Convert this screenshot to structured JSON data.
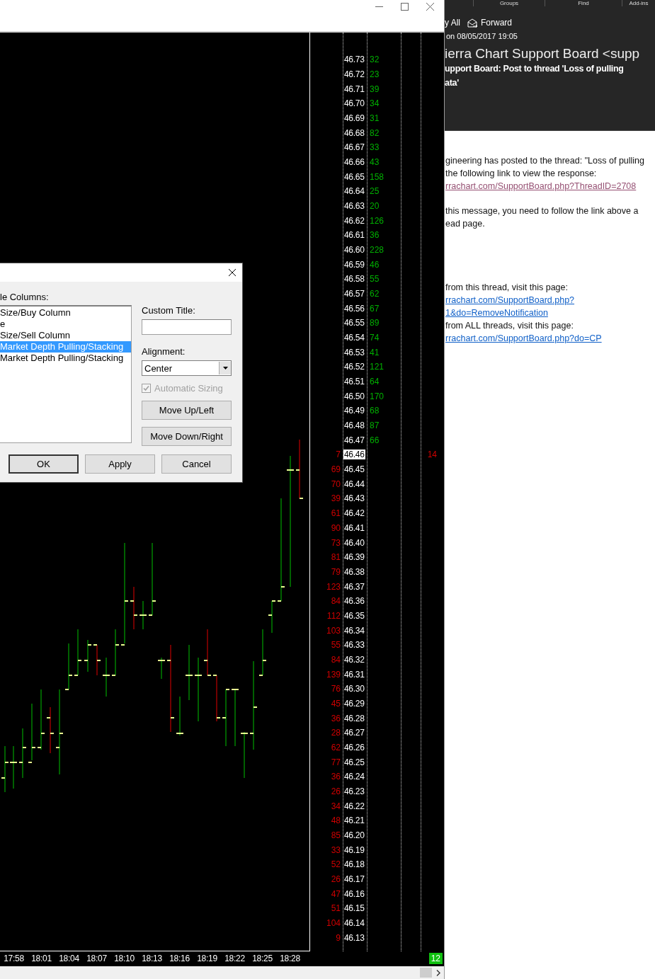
{
  "chart": {
    "ladder": {
      "rows": [
        {
          "price": "46.73",
          "ask": "32",
          "highlighted": false
        },
        {
          "price": "46.72",
          "ask": "23",
          "highlighted": false
        },
        {
          "price": "46.71",
          "ask": "39",
          "highlighted": false
        },
        {
          "price": "46.70",
          "ask": "34",
          "highlighted": false
        },
        {
          "price": "46.69",
          "ask": "31",
          "highlighted": false
        },
        {
          "price": "46.68",
          "ask": "82",
          "highlighted": false
        },
        {
          "price": "46.67",
          "ask": "33",
          "highlighted": false
        },
        {
          "price": "46.66",
          "ask": "43",
          "highlighted": false
        },
        {
          "price": "46.65",
          "ask": "158",
          "highlighted": false
        },
        {
          "price": "46.64",
          "ask": "25",
          "highlighted": false
        },
        {
          "price": "46.63",
          "ask": "20",
          "highlighted": false
        },
        {
          "price": "46.62",
          "ask": "126",
          "highlighted": false
        },
        {
          "price": "46.61",
          "ask": "36",
          "highlighted": false
        },
        {
          "price": "46.60",
          "ask": "228",
          "highlighted": false
        },
        {
          "price": "46.59",
          "ask": "46",
          "highlighted": false
        },
        {
          "price": "46.58",
          "ask": "55",
          "highlighted": false
        },
        {
          "price": "46.57",
          "ask": "62",
          "highlighted": false
        },
        {
          "price": "46.56",
          "ask": "67",
          "highlighted": false
        },
        {
          "price": "46.55",
          "ask": "89",
          "highlighted": false
        },
        {
          "price": "46.54",
          "ask": "74",
          "highlighted": false
        },
        {
          "price": "46.53",
          "ask": "41",
          "highlighted": false
        },
        {
          "price": "46.52",
          "ask": "121",
          "highlighted": false
        },
        {
          "price": "46.51",
          "ask": "64",
          "highlighted": false
        },
        {
          "price": "46.50",
          "ask": "170",
          "highlighted": false
        },
        {
          "price": "46.49",
          "ask": "68",
          "highlighted": false
        },
        {
          "price": "46.48",
          "ask": "87",
          "highlighted": false
        },
        {
          "price": "46.47",
          "ask": "66",
          "highlighted": false
        },
        {
          "price": "46.46",
          "bid": "7",
          "column_5": "14",
          "highlighted": true
        },
        {
          "price": "46.45",
          "bid": "69",
          "highlighted": false
        },
        {
          "price": "46.44",
          "bid": "70",
          "highlighted": false
        },
        {
          "price": "46.43",
          "bid": "39",
          "highlighted": false
        },
        {
          "price": "46.42",
          "bid": "61",
          "highlighted": false
        },
        {
          "price": "46.41",
          "bid": "90",
          "highlighted": false
        },
        {
          "price": "46.40",
          "bid": "73",
          "highlighted": false
        },
        {
          "price": "46.39",
          "bid": "81",
          "highlighted": false
        },
        {
          "price": "46.38",
          "bid": "79",
          "highlighted": false
        },
        {
          "price": "46.37",
          "bid": "123",
          "highlighted": false
        },
        {
          "price": "46.36",
          "bid": "84",
          "highlighted": false
        },
        {
          "price": "46.35",
          "bid": "112",
          "highlighted": false
        },
        {
          "price": "46.34",
          "bid": "103",
          "highlighted": false
        },
        {
          "price": "46.33",
          "bid": "55",
          "highlighted": false
        },
        {
          "price": "46.32",
          "bid": "84",
          "highlighted": false
        },
        {
          "price": "46.31",
          "bid": "139",
          "highlighted": false
        },
        {
          "price": "46.30",
          "bid": "76",
          "highlighted": false
        },
        {
          "price": "46.29",
          "bid": "45",
          "highlighted": false
        },
        {
          "price": "46.28",
          "bid": "36",
          "highlighted": false
        },
        {
          "price": "46.27",
          "bid": "28",
          "highlighted": false
        },
        {
          "price": "46.26",
          "bid": "62",
          "highlighted": false
        },
        {
          "price": "46.25",
          "bid": "77",
          "highlighted": false
        },
        {
          "price": "46.24",
          "bid": "36",
          "highlighted": false
        },
        {
          "price": "46.23",
          "bid": "26",
          "highlighted": false
        },
        {
          "price": "46.22",
          "bid": "34",
          "highlighted": false
        },
        {
          "price": "46.21",
          "bid": "48",
          "highlighted": false
        },
        {
          "price": "46.20",
          "bid": "85",
          "highlighted": false
        },
        {
          "price": "46.19",
          "bid": "33",
          "highlighted": false
        },
        {
          "price": "46.18",
          "bid": "52",
          "highlighted": false
        },
        {
          "price": "46.17",
          "bid": "26",
          "highlighted": false
        },
        {
          "price": "46.16",
          "bid": "47",
          "highlighted": false
        },
        {
          "price": "46.15",
          "bid": "51",
          "highlighted": false
        },
        {
          "price": "46.14",
          "bid": "104",
          "highlighted": false
        },
        {
          "price": "46.13",
          "bid": "9",
          "highlighted": false
        }
      ]
    },
    "time_axis": [
      "17:58",
      "18:01",
      "18:04",
      "18:07",
      "18:10",
      "18:13",
      "18:16",
      "18:19",
      "18:22",
      "18:25",
      "18:28"
    ],
    "badge": "12"
  },
  "dialog": {
    "columns_label": "le Columns:",
    "columns": [
      {
        "label": "Size/Buy Column",
        "selected": false
      },
      {
        "label": "e",
        "selected": false
      },
      {
        "label": "Size/Sell Column",
        "selected": false
      },
      {
        "label": "Market Depth Pulling/Stacking",
        "selected": true
      },
      {
        "label": "Market Depth Pulling/Stacking",
        "selected": false
      }
    ],
    "custom_title_label": "Custom Title:",
    "alignment_label": "Alignment:",
    "alignment_value": "Center",
    "automatic_sizing": {
      "label": "Automatic Sizing",
      "checked": true,
      "disabled": true
    },
    "side_buttons": [
      "Move Up/Left",
      "Move Down/Right"
    ],
    "buttons": [
      {
        "label": "OK",
        "default": true
      },
      {
        "label": "Apply",
        "default": false
      },
      {
        "label": "Cancel",
        "default": false
      }
    ]
  },
  "email": {
    "ribbon_groups": [
      "Groups",
      "Find",
      "Add-ins"
    ],
    "actions": [
      {
        "label": "y All",
        "kind": "reply_all"
      },
      {
        "label": "Forward",
        "kind": "forward"
      }
    ],
    "date": "on 08/05/2017 19:05",
    "sender": "ierra Chart Support Board <supp",
    "subject_lines": [
      "upport Board: Post to thread 'Loss of pulling",
      "ata'"
    ],
    "paragraphs": [
      [
        {
          "text": "gineering has posted to the thread: \"Loss of pulling",
          "kind": "text"
        },
        {
          "text": "the following link to  view the response:",
          "kind": "text"
        },
        {
          "text": "rrachart.com/SupportBoard.php?ThreadID=2708",
          "kind": "visited_link"
        }
      ],
      [
        {
          "text": "this message, you need to follow the link above a",
          "kind": "text"
        },
        {
          "text": "ead page.",
          "kind": "text"
        }
      ],
      [
        {
          "text": "from this thread, visit this page:",
          "kind": "text"
        },
        {
          "text": "rrachart.com/SupportBoard.php?",
          "kind": "link"
        },
        {
          "text": "1&do=RemoveNotification",
          "kind": "link"
        },
        {
          "text": "from ALL threads, visit this page:",
          "kind": "text"
        },
        {
          "text": "rrachart.com/SupportBoard.php?do=CP",
          "kind": "link"
        }
      ]
    ]
  }
}
